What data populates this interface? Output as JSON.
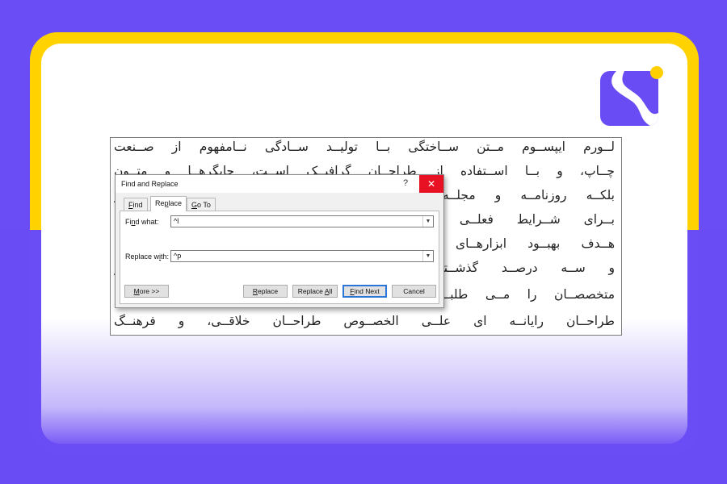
{
  "document_lines": [
    "لــورم ایپســوم مــتن ســاختگی بــا تولیــد ســادگی نــامفهوم از صــنعت",
    "چــاپ، و بــا اســتفاده از طراحــان گرافیــک اســت، چاپگرهــا و متــون",
    "بلکــه روزنامــه و مجلــه در ستون و سطرآنچنان که لازم است و",
    "بــرای شــرایط فعلــی تکنولوژی مورد نیاز و کاربردهای متنوع با",
    "هــدف بهبــود ابزارهــای کاربردی می باشد کتابهای زیادی در شصت",
    "و ســه درصــد گذشــته حال و آینده شناخت فراوان جامعه و",
    "متخصصــان را مــی طلبــد، تا با نرم افزارها شناخت بیشتری را برای",
    "طراحــان رایانــه ای علــی الخصــوص طراحــان خلاقــی، و فرهنــگ"
  ],
  "dialog": {
    "title": "Find and Replace",
    "help": "?",
    "close": "✕",
    "tabs": {
      "find": {
        "u": "F",
        "rest": "ind"
      },
      "replace": {
        "pre": "Re",
        "u": "p",
        "rest": "lace"
      },
      "goto": {
        "u": "G",
        "rest": "o To"
      }
    },
    "find_label": {
      "pre": "Fi",
      "u": "n",
      "rest": "d what:"
    },
    "find_value": "^l",
    "replace_label": {
      "pre": "Replace w",
      "u": "i",
      "rest": "th:"
    },
    "replace_value": "^p",
    "buttons": {
      "more": {
        "u": "M",
        "rest": "ore >>"
      },
      "replace": {
        "u": "R",
        "rest": "eplace"
      },
      "replace_all": {
        "pre": "Replace ",
        "u": "A",
        "rest": "ll"
      },
      "find_next": {
        "u": "F",
        "rest": "ind Next"
      },
      "cancel": "Cancel"
    },
    "dropdown_arrow": "▼"
  },
  "colors": {
    "brand_purple": "#6a4cf5",
    "brand_yellow": "#ffd200",
    "close_red": "#e81123",
    "default_button_border": "#2b74d8"
  },
  "icons": {
    "logo": "brand-s-logo"
  }
}
